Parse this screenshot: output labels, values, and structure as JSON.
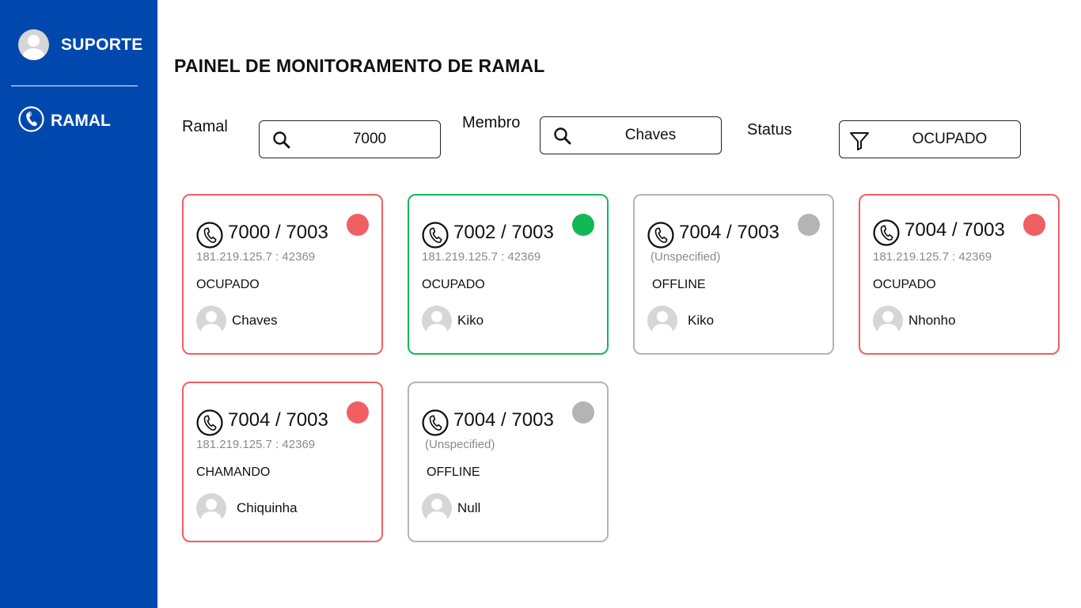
{
  "sidebar": {
    "user_label": "SUPORTE",
    "ramal_label": "RAMAL",
    "background": "#0048ad"
  },
  "header": {
    "title": "PAINEL DE MONITORAMENTO DE RAMAL"
  },
  "filters": {
    "ramal": {
      "label": "Ramal",
      "value": "7000",
      "icon": "search-icon"
    },
    "membro": {
      "label": "Membro",
      "value": "Chaves",
      "icon": "search-icon"
    },
    "status": {
      "label": "Status",
      "value": "OCUPADO",
      "icon": "filter-icon"
    }
  },
  "status_colors": {
    "busy": "#f05f62",
    "available": "#13b856",
    "offline": "#b4b4b4"
  },
  "cards": [
    {
      "number": "7000 / 7003",
      "address": "181.219.125.7 : 42369",
      "status": "OCUPADO",
      "member": "Chaves"
    },
    {
      "number": "7002 / 7003",
      "address": "181.219.125.7 : 42369",
      "status": "OCUPADO",
      "member": "Kiko"
    },
    {
      "number": "7004 / 7003",
      "address": "(Unspecified)",
      "status": "OFFLINE",
      "member": "Kiko"
    },
    {
      "number": "7004 / 7003",
      "address": "181.219.125.7 : 42369",
      "status": "OCUPADO",
      "member": "Nhonho"
    },
    {
      "number": "7004 / 7003",
      "address": "181.219.125.7 : 42369",
      "status": "CHAMANDO",
      "member": "Chiquinha"
    },
    {
      "number": "7004 / 7003",
      "address": "(Unspecified)",
      "status": "OFFLINE",
      "member": "Null"
    }
  ]
}
